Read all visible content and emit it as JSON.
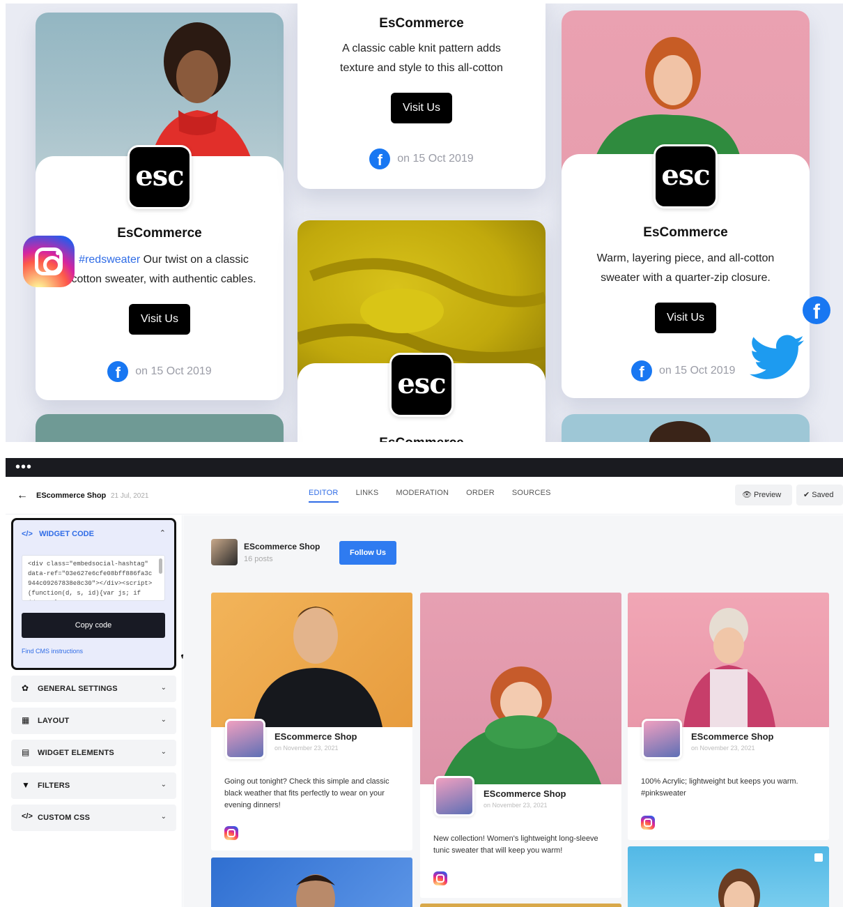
{
  "showcase": {
    "cards": [
      {
        "brand": "EsCommerce",
        "hashtag": "#redsweater",
        "text_a": "Our twist on a classic",
        "text_b": "cotton sweater, with authentic cables.",
        "button": "Visit Us",
        "date": "on 15 Oct 2019",
        "logo": "esc"
      },
      {
        "brand": "EsCommerce",
        "text_a": "A classic cable knit pattern adds",
        "text_b": "texture and style to this all-cotton",
        "button": "Visit Us",
        "date": "on 15 Oct 2019"
      },
      {
        "brand": "EsCommerce",
        "logo": "esc"
      },
      {
        "brand": "EsCommerce",
        "text_a": "Warm, layering piece, and all-cotton",
        "text_b": "sweater with a quarter-zip closure.",
        "button": "Visit Us",
        "date": "on 15 Oct 2019",
        "logo": "esc"
      }
    ],
    "floating_icons": [
      "instagram-icon",
      "facebook-icon",
      "twitter-icon"
    ]
  },
  "app": {
    "window_dots": "•••",
    "header": {
      "back_icon": "←",
      "shop_name": "EScommerce Shop",
      "shop_date": "21 Jul, 2021",
      "tabs": [
        "EDITOR",
        "LINKS",
        "MODERATION",
        "ORDER",
        "SOURCES"
      ],
      "active_tab": "EDITOR",
      "preview_label": "Preview",
      "saved_label": "Saved"
    },
    "sidebar": {
      "widget_code_title": "WIDGET CODE",
      "code": "<div class=\"embedsocial-hashtag\" data-ref=\"03e627e6cfe08bff886fa3c944c09267838e8c30\"></div><script>(function(d, s, id){var js; if (d.getEleme",
      "copy_label": "Copy code",
      "cms_link": "Find CMS instructions",
      "sections": [
        {
          "label": "GENERAL SETTINGS",
          "icon": "gear-icon",
          "glyph": "✿"
        },
        {
          "label": "LAYOUT",
          "icon": "layout-icon",
          "glyph": "▦"
        },
        {
          "label": "WIDGET ELEMENTS",
          "icon": "elements-icon",
          "glyph": "▤"
        },
        {
          "label": "FILTERS",
          "icon": "filter-icon",
          "glyph": "▼"
        },
        {
          "label": "CUSTOM CSS",
          "icon": "code-icon",
          "glyph": "</>"
        }
      ]
    },
    "feed": {
      "profile_name": "EScommerce Shop",
      "profile_posts": "16 posts",
      "follow_label": "Follow Us",
      "posts": [
        {
          "author": "EScommerce Shop",
          "date": "on November 23, 2021",
          "text": "Going out tonight? Check this simple and classic black weather that fits perfectly to wear on your evening dinners!"
        },
        {
          "author": "EScommerce Shop",
          "date": "on November 23, 2021",
          "text": "New collection! Women's lightweight long-sleeve tunic sweater that will keep you warm!"
        },
        {
          "author": "EScommerce Shop",
          "date": "on November 23, 2021",
          "text": "100% Acrylic; lightweight but keeps you warm. #pinksweater"
        }
      ]
    }
  },
  "colors": {
    "accent": "#2f6ce6",
    "facebook": "#1877f2",
    "twitter": "#1d9bf0",
    "button_dark": "#000000"
  }
}
